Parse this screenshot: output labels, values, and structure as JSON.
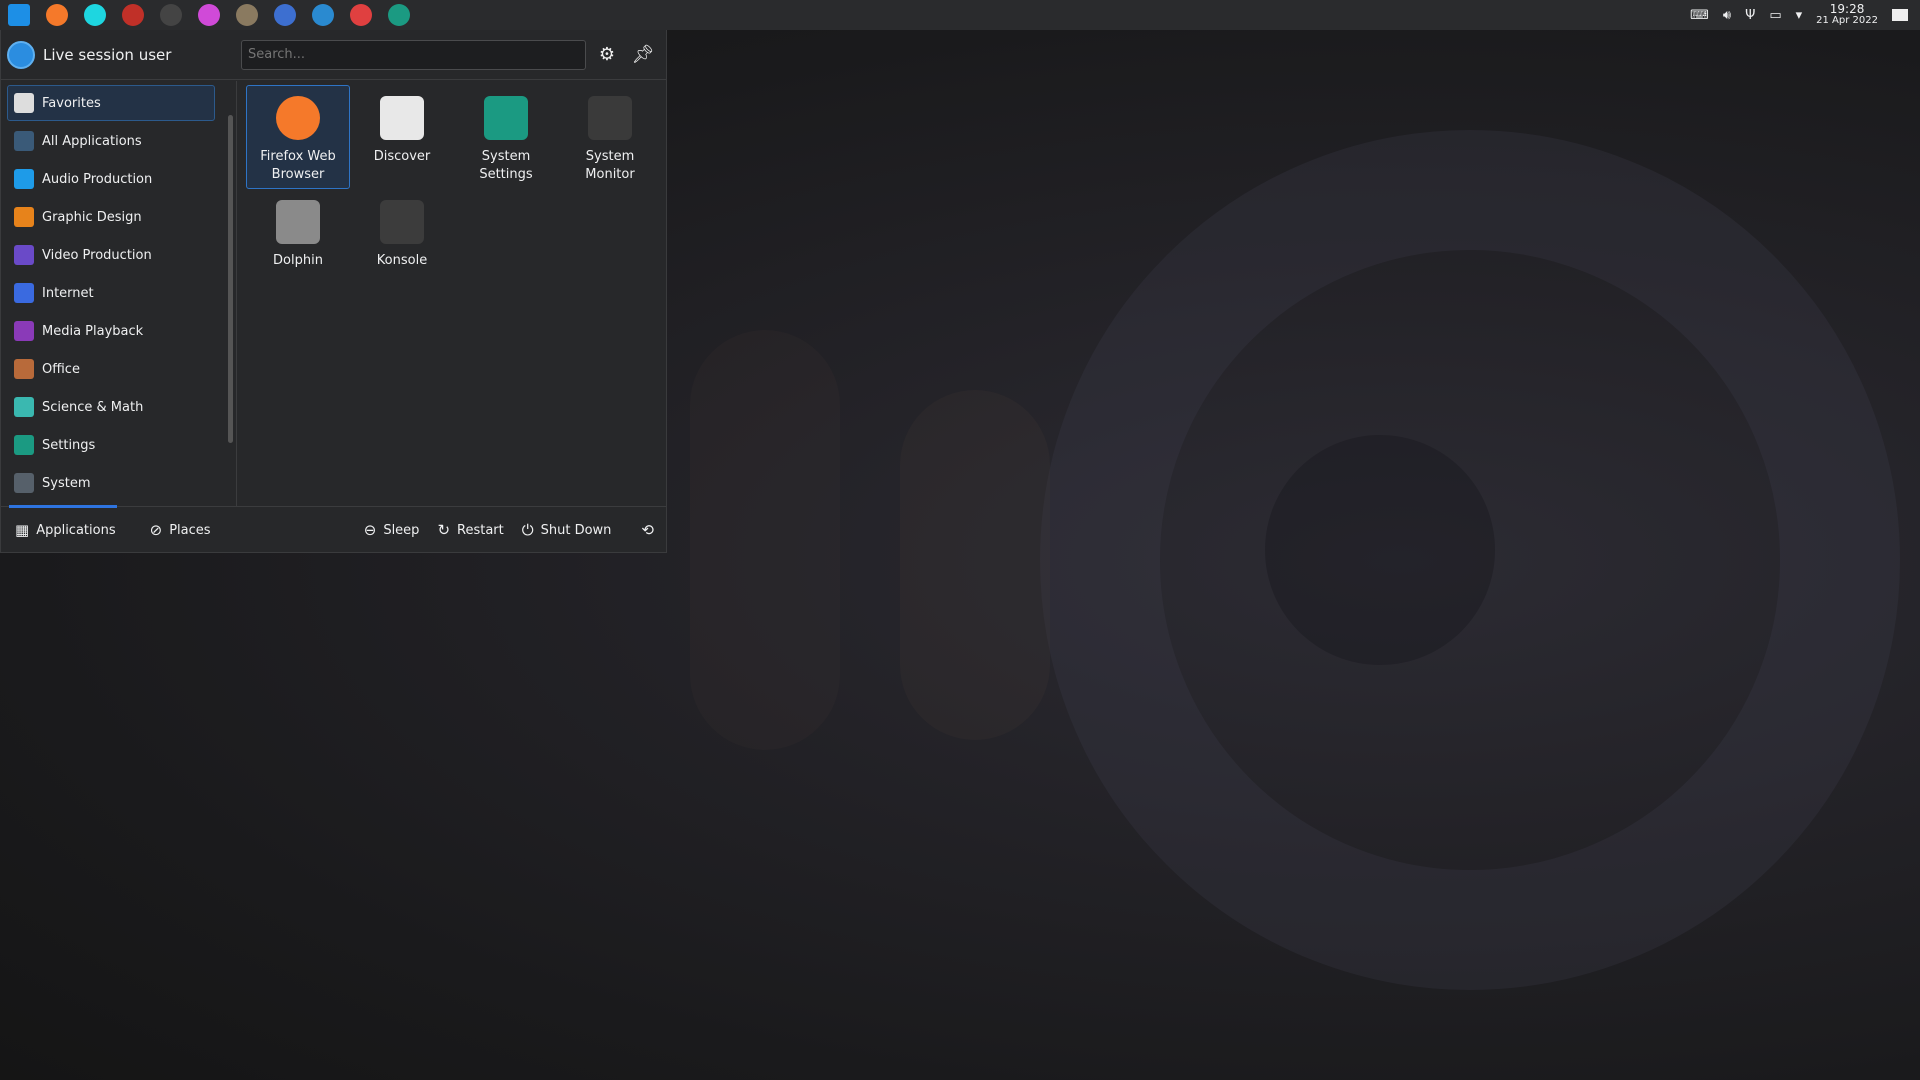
{
  "taskbar": {
    "launchers": [
      {
        "name": "ubuntu-studio-launcher-icon",
        "color": "#1d8fe6"
      },
      {
        "name": "firefox-icon",
        "color": "#f5792a"
      },
      {
        "name": "carla-icon",
        "color": "#1ed6e0"
      },
      {
        "name": "ardour-icon",
        "color": "#c03028"
      },
      {
        "name": "obs-icon",
        "color": "#444"
      },
      {
        "name": "krita-icon",
        "color": "#d04ad8"
      },
      {
        "name": "gimp-icon",
        "color": "#8a7a60"
      },
      {
        "name": "kdenlive-icon",
        "color": "#3d6fd0"
      },
      {
        "name": "darktable-icon",
        "color": "#2a8ad0"
      },
      {
        "name": "digikam-icon",
        "color": "#e04040"
      },
      {
        "name": "system-settings-icon",
        "color": "#1b9a82"
      }
    ],
    "tray": {
      "time": "19:28",
      "date": "21 Apr 2022"
    }
  },
  "menu": {
    "user": "Live session user",
    "search_placeholder": "Search...",
    "categories": [
      {
        "label": "Favorites",
        "color": "#ddd"
      },
      {
        "label": "All Applications",
        "color": "#3a5a78"
      },
      {
        "label": "Audio Production",
        "color": "#1e9be8"
      },
      {
        "label": "Graphic Design",
        "color": "#e7831b"
      },
      {
        "label": "Video Production",
        "color": "#6a4ac8"
      },
      {
        "label": "Internet",
        "color": "#3a6ae0"
      },
      {
        "label": "Media Playback",
        "color": "#8a3ab8"
      },
      {
        "label": "Office",
        "color": "#b86a3a"
      },
      {
        "label": "Science & Math",
        "color": "#3ab8b0"
      },
      {
        "label": "Settings",
        "color": "#1b9a82"
      },
      {
        "label": "System",
        "color": "#56606a"
      }
    ],
    "favorites": [
      {
        "label": "Firefox Web Browser",
        "color": "#f5792a"
      },
      {
        "label": "Discover",
        "color": "#e8e8e8"
      },
      {
        "label": "System Settings",
        "color": "#1b9a82"
      },
      {
        "label": "System Monitor",
        "color": "#3a3a3a"
      },
      {
        "label": "Dolphin",
        "color": "#8a8a8a"
      },
      {
        "label": "Konsole",
        "color": "#3c3c3c"
      }
    ],
    "footer": {
      "applications": "Applications",
      "places": "Places",
      "sleep": "Sleep",
      "restart": "Restart",
      "shutdown": "Shut Down"
    }
  }
}
